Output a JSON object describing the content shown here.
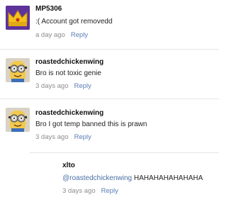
{
  "comments": [
    {
      "username": "MP5306",
      "text": ":( Account got removedd",
      "time": "a day ago",
      "reply": "Reply",
      "avatar_icon": "crown-avatar-icon"
    },
    {
      "username": "roastedchickenwing",
      "text": "Bro is not toxic genie",
      "time": "3 days ago",
      "reply": "Reply",
      "avatar_icon": "minion-avatar-icon"
    },
    {
      "username": "roastedchickenwing",
      "text": "Bro I got temp banned this is prawn",
      "time": "3 days ago",
      "reply": "Reply",
      "avatar_icon": "minion-avatar-icon"
    },
    {
      "username": "xlto",
      "mention": "@roastedchickenwing",
      "text": "HAHAHAHAHAHAHA",
      "time": "3 days ago",
      "reply": "Reply"
    }
  ],
  "colors": {
    "link": "#5a7db5",
    "meta": "#8c8c8c",
    "separator": "#e6e6e6"
  }
}
